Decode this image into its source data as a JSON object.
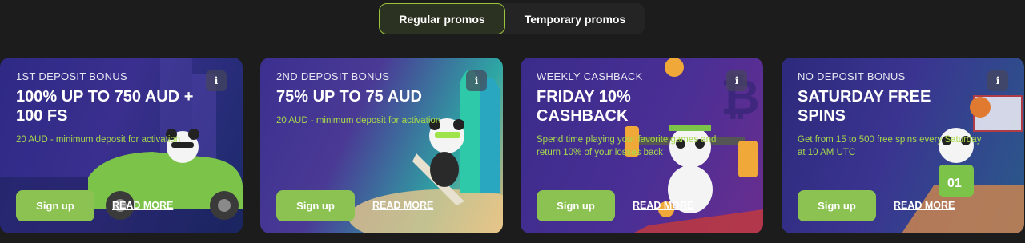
{
  "tabs": {
    "regular": "Regular promos",
    "temporary": "Temporary promos"
  },
  "info_icon": "i",
  "cards": [
    {
      "eyebrow": "1ST DEPOSIT BONUS",
      "title": "100% UP TO 750 AUD + 100 FS",
      "desc": "20 AUD - minimum deposit for activation",
      "signup": "Sign up",
      "readmore": "READ MORE"
    },
    {
      "eyebrow": "2ND DEPOSIT BONUS",
      "title": "75% UP TO 75 AUD",
      "desc": "20 AUD - minimum deposit for activation",
      "signup": "Sign up",
      "readmore": "READ MORE"
    },
    {
      "eyebrow": "WEEKLY CASHBACK",
      "title": "FRIDAY 10% CASHBACK",
      "desc": "Spend time playing your favorite games and return 10% of your losses back",
      "signup": "Sign up",
      "readmore": "READ MORE"
    },
    {
      "eyebrow": "NO DEPOSIT BONUS",
      "title": "SATURDAY FREE SPINS",
      "desc": "Get from 15 to 500 free spins every Saturday at 10 AM UTC",
      "signup": "Sign up",
      "readmore": "READ MORE"
    }
  ],
  "badge_number": "01",
  "colors": {
    "accent": "#8cc251",
    "desc_green": "#a6d94a",
    "active_tab_border": "#9bc43c",
    "background": "#1c1c1c"
  }
}
